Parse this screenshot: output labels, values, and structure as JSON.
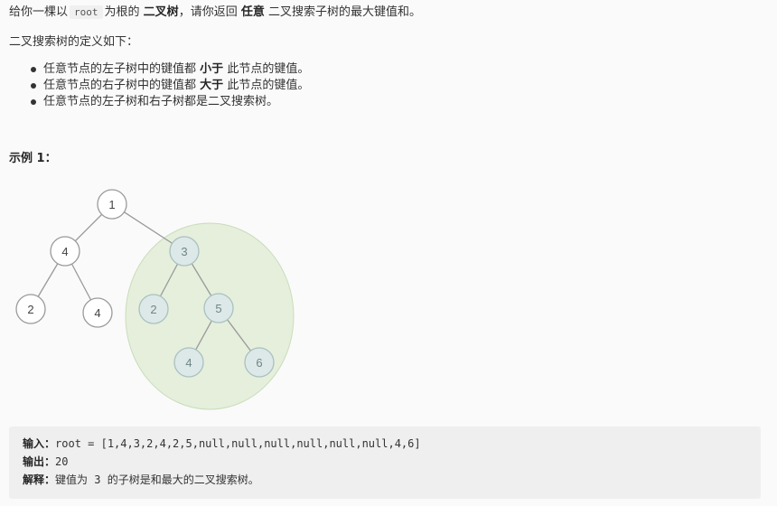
{
  "intro": {
    "p1": "给你一棵以",
    "code_root": "root",
    "p2": "为根的",
    "bold_tree": "二叉树",
    "p3": "，请你返回",
    "bold_any": "任意",
    "p4": "二叉搜索子树的最大键值和。"
  },
  "definition_heading": "二叉搜索树的定义如下：",
  "rules": [
    {
      "pre": "任意节点的左子树中的键值都",
      "bold": "小于",
      "post": "此节点的键值。"
    },
    {
      "pre": "任意节点的右子树中的键值都",
      "bold": "大于",
      "post": "此节点的键值。"
    },
    {
      "pre": "任意节点的左子树和右子树都是二叉搜索树。",
      "bold": "",
      "post": ""
    }
  ],
  "example_title": "示例 1：",
  "tree": {
    "nodes": [
      "1",
      "4",
      "3",
      "2",
      "4",
      "2",
      "5",
      "4",
      "6"
    ],
    "colors": {
      "node_fill": "#ffffff",
      "node_stroke": "#9a9a9a",
      "highlight_fill": "#dde9e8",
      "highlight_stroke": "#a9c0c0",
      "ellipse_fill": "#e5efdc",
      "ellipse_stroke": "#cadcba",
      "edge": "#9a9a9a"
    }
  },
  "io": {
    "input_label": "输入：",
    "input_value": "root = [1,4,3,2,4,2,5,null,null,null,null,null,null,4,6]",
    "output_label": "输出：",
    "output_value": "20",
    "explain_label": "解释：",
    "explain_pre": "键值为",
    "explain_code": "3",
    "explain_post": "的子树是和最大的二叉搜索树。"
  }
}
